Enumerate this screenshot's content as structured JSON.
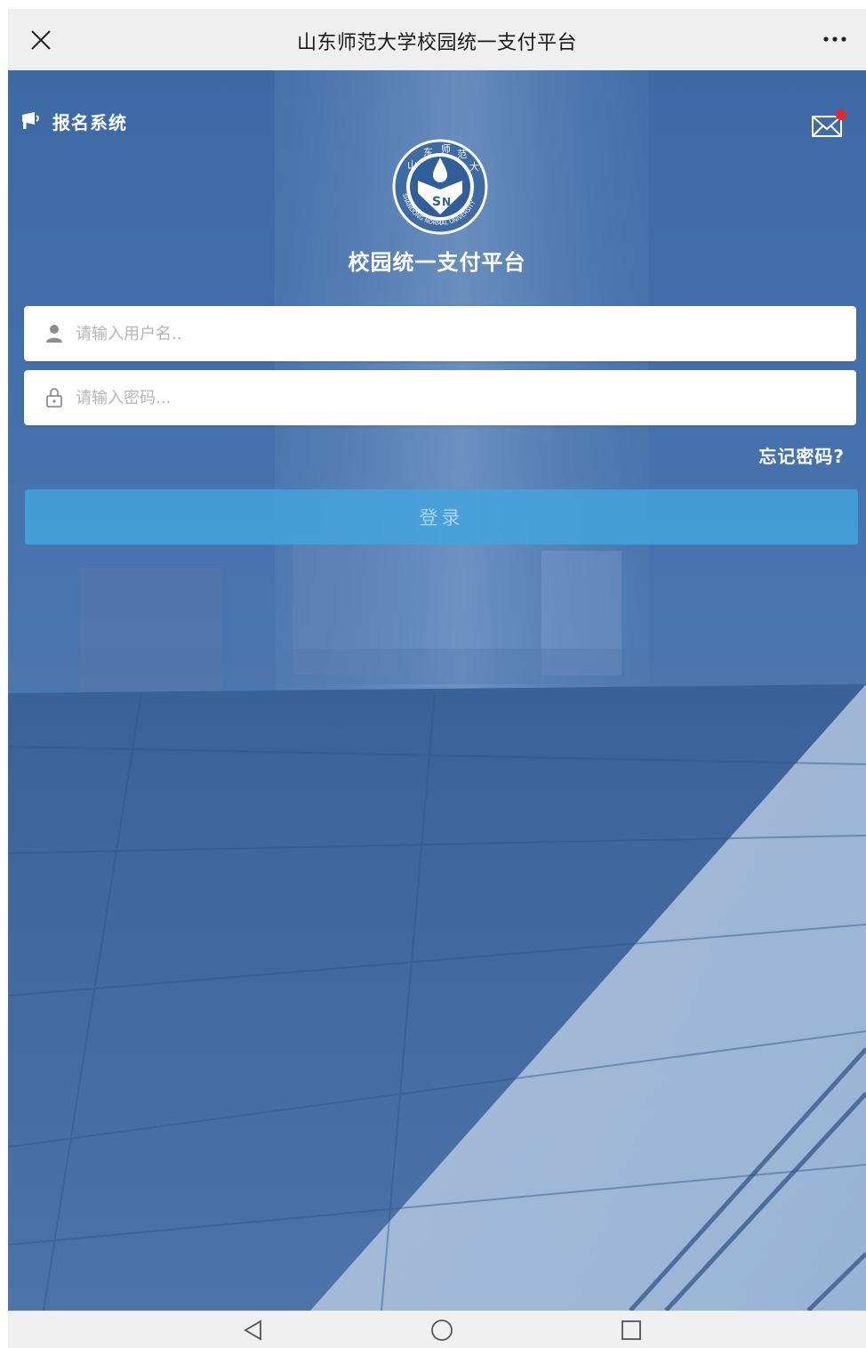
{
  "window": {
    "title": "山东师范大学校园统一支付平台",
    "close_icon": "close-icon",
    "more_icon": "more-icon"
  },
  "header": {
    "notice_icon": "megaphone-icon",
    "notice_label": "报名系统",
    "mail_icon": "mail-icon",
    "mail_badge_color": "#e8262a"
  },
  "brand": {
    "logo": "university-seal-logo",
    "logo_text": "SHANDONG NORMAL UNIVERSITY",
    "platform_name": "校园统一支付平台"
  },
  "form": {
    "username_placeholder": "请输入用户名..",
    "password_placeholder": "请输入密码...",
    "forgot_label": "忘记密码?",
    "login_label": "登录"
  },
  "nav": {
    "back_icon": "back-triangle-icon",
    "home_icon": "home-circle-icon",
    "recents_icon": "recents-square-icon"
  },
  "colors": {
    "background": "#4a79b2",
    "button": "#43a4de",
    "button_text": "#a9d5f2"
  }
}
